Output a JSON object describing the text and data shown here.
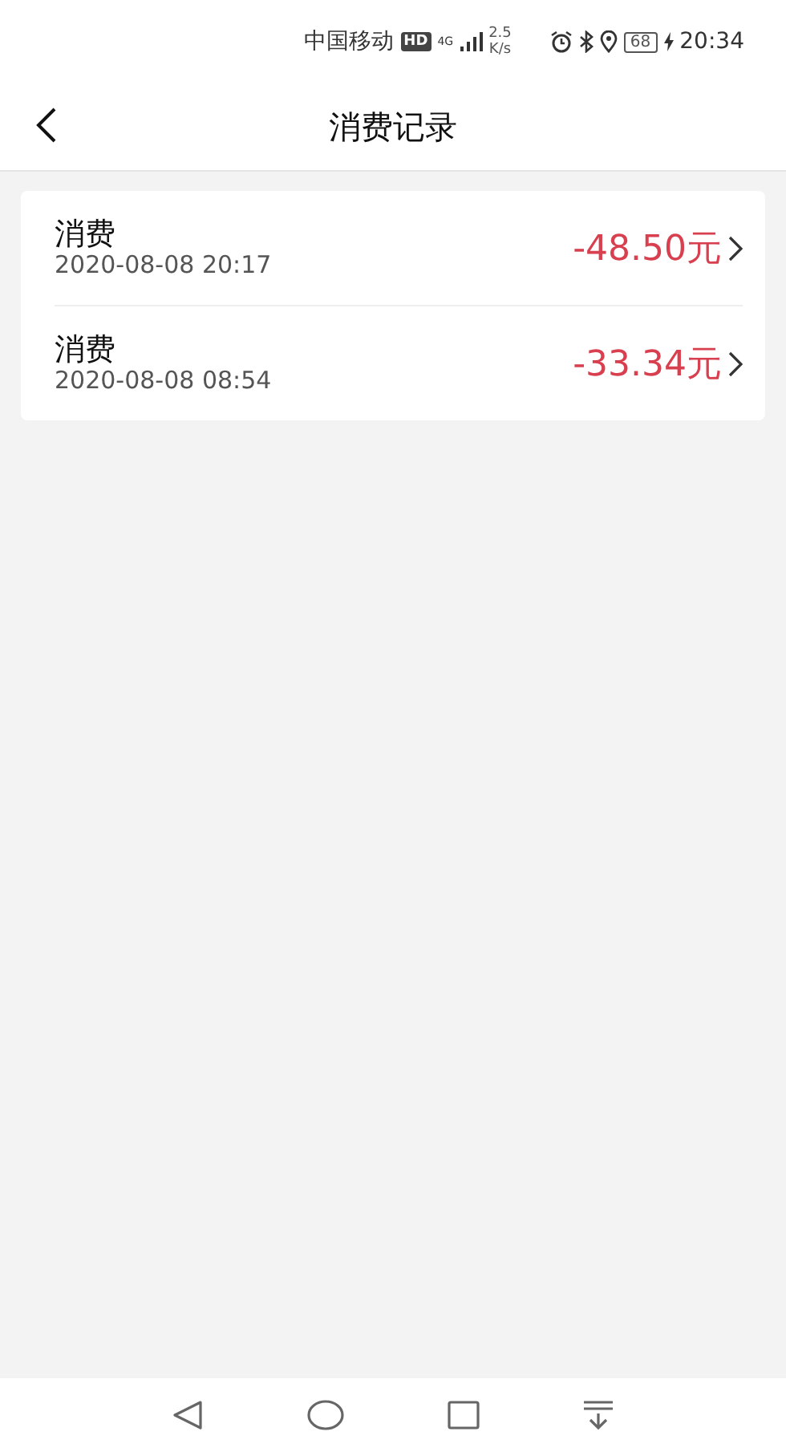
{
  "status_bar": {
    "carrier": "中国移动",
    "hd_badge": "HD",
    "network": "4G",
    "speed_value": "2.5",
    "speed_unit": "K/s",
    "battery": "68",
    "time": "20:34"
  },
  "header": {
    "title": "消费记录"
  },
  "records": [
    {
      "title": "消费",
      "datetime": "2020-08-08 20:17",
      "amount": "-48.50元"
    },
    {
      "title": "消费",
      "datetime": "2020-08-08 08:54",
      "amount": "-33.34元"
    }
  ]
}
